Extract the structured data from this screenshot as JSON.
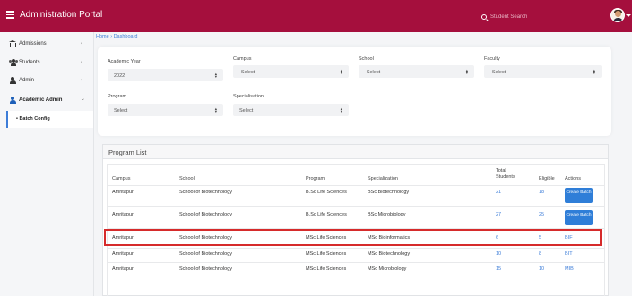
{
  "app": {
    "title": "Administration Portal"
  },
  "search": {
    "placeholder": "Student Search"
  },
  "sidebar": {
    "items": [
      {
        "label": "Admissions",
        "chevron": "‹"
      },
      {
        "label": "Students",
        "chevron": "‹"
      },
      {
        "label": "Admin",
        "chevron": "‹"
      },
      {
        "label": "Academic Admin",
        "chevron": "⌄"
      }
    ],
    "subitem": {
      "label": "• Batch Config"
    }
  },
  "breadcrumb": {
    "home": "Home",
    "separator": " › ",
    "current": "Dashboard"
  },
  "filters": {
    "academic_year": {
      "label": "Academic Year",
      "value": "2022"
    },
    "campus": {
      "label": "Campus",
      "value": "-Select-"
    },
    "school": {
      "label": "School",
      "value": "-Select-"
    },
    "faculty": {
      "label": "Faculty",
      "value": "-Select-"
    },
    "program": {
      "label": "Program",
      "value": "Select"
    },
    "specialisation": {
      "label": "Specialisation",
      "value": "Select"
    }
  },
  "program_list": {
    "title": "Program List",
    "columns": [
      "Campus",
      "School",
      "Program",
      "Specialization",
      "Total Students",
      "Eligible",
      "Actions"
    ],
    "rows": [
      {
        "campus": "Amritapuri",
        "school": "School of Biotechnology",
        "program": "B.Sc Life Sciences",
        "specialization": "BSc Biotechnology",
        "total": "21",
        "eligible": "18",
        "action": "Create Batch"
      },
      {
        "campus": "Amritapuri",
        "school": "School of Biotechnology",
        "program": "B.Sc Life Sciences",
        "specialization": "BSc Microbiology",
        "total": "27",
        "eligible": "25",
        "action": "Create Batch"
      },
      {
        "campus": "Amritapuri",
        "school": "School of Biotechnology",
        "program": "MSc Life Sciences",
        "specialization": "MSc Bioinformatics",
        "total": "6",
        "eligible": "5",
        "action": "BIF"
      },
      {
        "campus": "Amritapuri",
        "school": "School of Biotechnology",
        "program": "MSc Life Sciences",
        "specialization": "MSc Biotechnology",
        "total": "10",
        "eligible": "8",
        "action": "BIT"
      },
      {
        "campus": "Amritapuri",
        "school": "School of Biotechnology",
        "program": "MSc Life Sciences",
        "specialization": "MSc Microbiology",
        "total": "15",
        "eligible": "10",
        "action": "MIB"
      }
    ]
  },
  "colors": {
    "topbar": "#a50f3d",
    "accent": "#3d7dd8",
    "button": "#2f7ed8",
    "highlight": "#d62b2b"
  },
  "icons": [
    "hamburger-icon",
    "search-icon",
    "avatar",
    "institution-icon",
    "users-icon",
    "user-icon",
    "user-admin-icon",
    "sort-arrows-icon"
  ]
}
